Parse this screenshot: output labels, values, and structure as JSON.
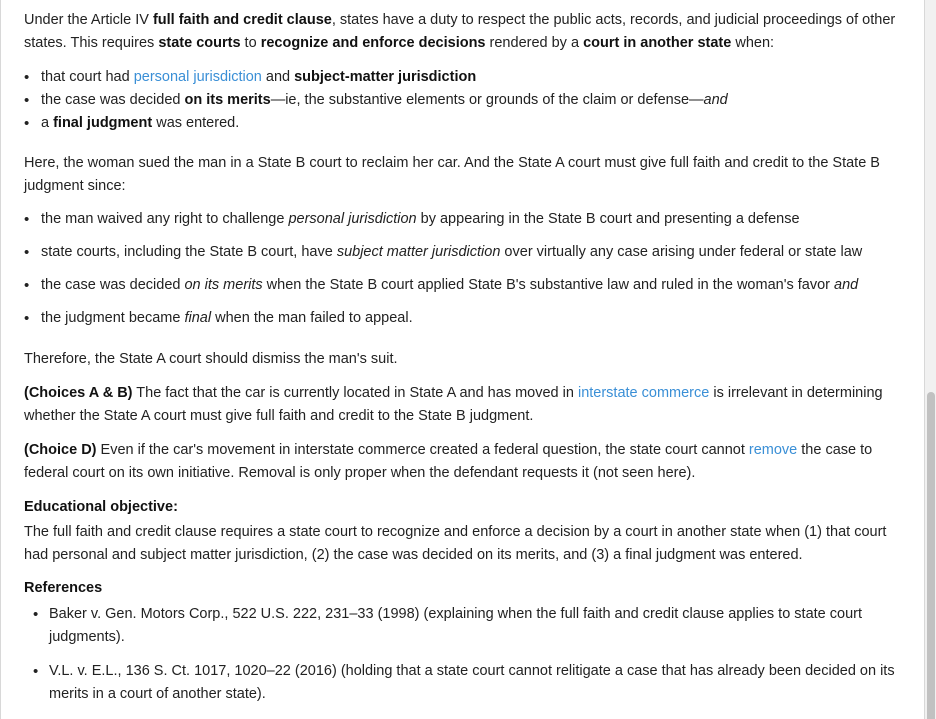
{
  "intro": {
    "t1": "Under the Article IV ",
    "b1": "full faith and credit clause",
    "t2": ", states have a duty to respect the public acts, records, and judicial proceedings of other states.  This requires ",
    "b2": "state courts",
    "t3": " to ",
    "b3": "recognize and enforce decisions",
    "t4": " rendered by a ",
    "b4": "court in another state",
    "t5": " when:"
  },
  "req_list": {
    "i1_t1": "that court had ",
    "i1_link": "personal jurisdiction",
    "i1_t2": " and ",
    "i1_b": "subject-matter jurisdiction",
    "i2_t1": "the case was decided ",
    "i2_b": "on its merits",
    "i2_t2": "—ie, the substantive elements or grounds of the claim or defense—",
    "i2_i": "and",
    "i3_t1": "a ",
    "i3_b": "final judgment",
    "i3_t2": " was entered."
  },
  "here": "Here, the woman sued the man in a State B court to reclaim her car.  And the State A court must give full faith and credit to the State B judgment since:",
  "facts_list": {
    "f1_t1": "the man waived any right to challenge ",
    "f1_i": "personal jurisdiction",
    "f1_t2": " by appearing in the State B court and presenting a defense",
    "f2_t1": "state courts, including the State B court, have ",
    "f2_i": "subject matter jurisdiction",
    "f2_t2": " over virtually any case arising under federal or state law",
    "f3_t1": "the case was decided ",
    "f3_i": "on its merits",
    "f3_t2": " when the State B court applied State B's substantive law and ruled in the woman's favor ",
    "f3_i2": "and",
    "f4_t1": "the judgment became ",
    "f4_i": "final",
    "f4_t2": " when the man failed to appeal."
  },
  "therefore": "Therefore, the State A court should dismiss the man's suit.",
  "choice_ab": {
    "label": "(Choices A & B)",
    "t1": "  The fact that the car is currently located in State A and has moved in ",
    "link": "interstate commerce",
    "t2": " is irrelevant in determining whether the State A court must give full faith and credit to the State B judgment."
  },
  "choice_d": {
    "label": "(Choice D)",
    "t1": "  Even if the car's movement in interstate commerce created a federal question, the state court cannot ",
    "link": "remove",
    "t2": " the case to federal court on its own initiative.  Removal is only proper when the defendant requests it (not seen here)."
  },
  "objective": {
    "heading": "Educational objective:",
    "text": "The full faith and credit clause requires a state court to recognize and enforce a decision by a court in another state when (1) that court had personal and subject matter jurisdiction, (2) the case was decided on its merits, and (3) a final judgment was entered."
  },
  "references": {
    "heading": "References",
    "items": [
      "Baker v. Gen. Motors Corp., 522 U.S. 222, 231–33 (1998) (explaining when the full faith and credit clause applies to state court judgments).",
      "V.L. v. E.L., 136 S. Ct. 1017, 1020–22 (2016) (holding that a state court cannot relitigate a case that has already been decided on its merits in a court of another state)."
    ]
  }
}
